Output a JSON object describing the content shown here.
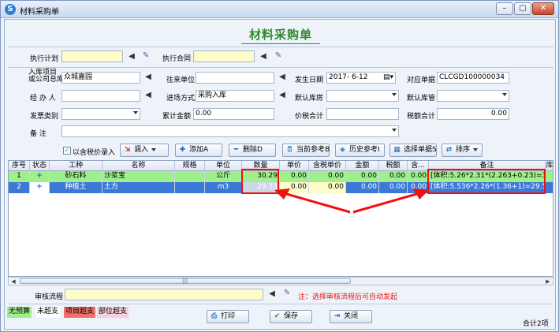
{
  "window": {
    "title": "材料采购单"
  },
  "form": {
    "title": "材料采购单",
    "labels": {
      "plan": "执行计划",
      "contract": "执行合同",
      "project_l1": "入库项目",
      "project_l2": "或公司总库",
      "unit": "往来单位",
      "date": "发生日期",
      "doc_no": "对应单据",
      "handler": "经 办 人",
      "in_method": "进场方式",
      "default_wh": "默认库房",
      "default_keeper": "默认库管",
      "invoice_type": "发票类别",
      "total_amount": "累计金额",
      "tax_total": "价税合计",
      "tax_amount": "税额合计",
      "remark": "备    注"
    },
    "values": {
      "plan": "",
      "contract": "",
      "project": "众城嘉园",
      "unit": "",
      "date": "2017- 6-12",
      "doc_no": "CLCGD100000034",
      "handler": "",
      "in_method": "采购入库",
      "default_wh": "",
      "default_keeper": "",
      "invoice_type": "",
      "total_amount": "0.00",
      "tax_total": "",
      "tax_amount": "0.00",
      "remark": ""
    }
  },
  "toolbar": {
    "tax_price_label": "以含税价录入",
    "import_label": "调入",
    "add_label": "添加A",
    "delete_label": "删除D",
    "current_ref_label": "当前参考B",
    "history_ref_label": "历史参考I",
    "select_doc_label": "选择单据S",
    "sort_label": "排序"
  },
  "table": {
    "headers": [
      "序号",
      "状态",
      "工种",
      "名称",
      "规格",
      "单位",
      "数量",
      "单价",
      "含税单价",
      "金额",
      "税额",
      "含...",
      "备注",
      "库"
    ],
    "rows": [
      {
        "no": "1",
        "status": "+",
        "work_type": "砂石料",
        "name": "沙浆宝",
        "spec": "",
        "unit": "公斤",
        "qty": "30.29",
        "price": "0.00",
        "tax_price": "0.00",
        "amount": "0.00",
        "tax": "0.00",
        "incl": "0.00",
        "note": "[体积:5.26*2.31*(2.263+0.23)=30.291"
      },
      {
        "no": "2",
        "status": "+",
        "work_type": "种植土",
        "name": "土方",
        "spec": "",
        "unit": "m3",
        "qty": "29.53",
        "price": "0.00",
        "tax_price": "0.00",
        "amount": "0.00",
        "tax": "0.00",
        "incl": "0.00",
        "note": "[体积:5.536*2.26*(1.36+1)=29.526809"
      }
    ]
  },
  "approval": {
    "label": "审核流程",
    "value": "",
    "note": "注：选择审核流程后可自动发起"
  },
  "legend": {
    "no_budget": "无预算",
    "not_over": "未超支",
    "project_over": "项目超支",
    "part_over": "部位超支"
  },
  "buttons": {
    "print": "打印",
    "save": "保存",
    "close": "关闭"
  },
  "status": {
    "total": "合计2项"
  },
  "colors": {
    "title_green": "#2c8b2c",
    "input_yellow": "#fefcc8",
    "row_green": "#9ff08c",
    "row_selected": "#3b78d8",
    "highlight_red": "#e11111"
  }
}
